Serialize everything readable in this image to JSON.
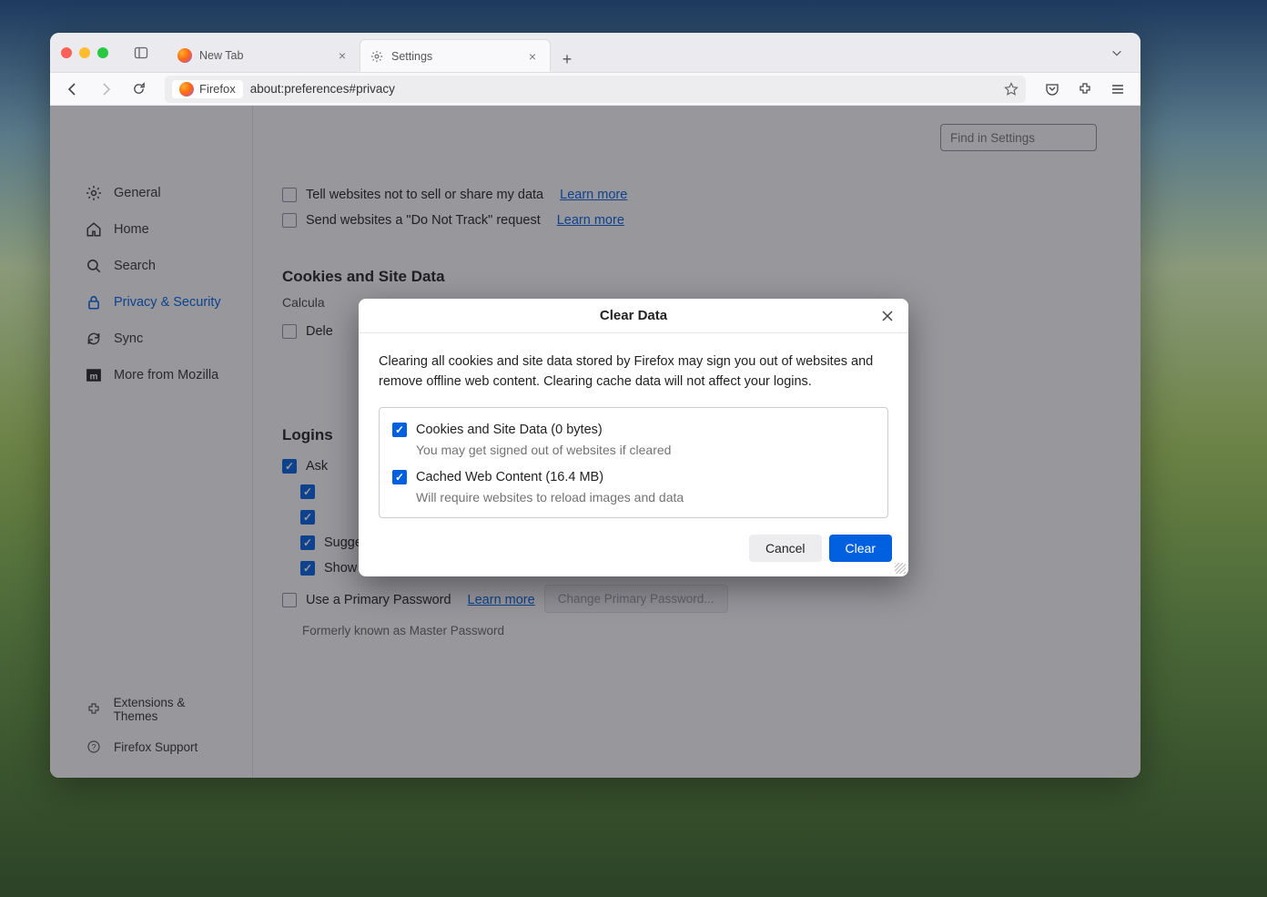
{
  "tabs": [
    {
      "label": "New Tab",
      "active": false
    },
    {
      "label": "Settings",
      "active": true
    }
  ],
  "urlbar": {
    "identity": "Firefox",
    "url": "about:preferences#privacy"
  },
  "search": {
    "placeholder": "Find in Settings"
  },
  "sidebar": {
    "items": [
      {
        "label": "General"
      },
      {
        "label": "Home"
      },
      {
        "label": "Search"
      },
      {
        "label": "Privacy & Security"
      },
      {
        "label": "Sync"
      },
      {
        "label": "More from Mozilla"
      }
    ],
    "footer": [
      {
        "label": "Extensions & Themes"
      },
      {
        "label": "Firefox Support"
      }
    ]
  },
  "privacy": {
    "dnt_sell": "Tell websites not to sell or share my data",
    "dnt_track": "Send websites a \"Do Not Track\" request",
    "learn": "Learn more",
    "cookies_title": "Cookies and Site Data",
    "cookies_calc": "Calcula",
    "cookies_delete": "Dele",
    "logins_title": "Logins",
    "ask": "Ask",
    "relay": "Suggest Firefox Relay email masks to protect your email address",
    "breach": "Show alerts about passwords for breached websites",
    "primary": "Use a Primary Password",
    "primary_note": "Formerly known as Master Password",
    "change_btn": "Change Primary Password..."
  },
  "dialog": {
    "title": "Clear Data",
    "desc": "Clearing all cookies and site data stored by Firefox may sign you out of websites and remove offline web content. Clearing cache data will not affect your logins.",
    "opt1": "Cookies and Site Data (0 bytes)",
    "opt1_sub": "You may get signed out of websites if cleared",
    "opt2": "Cached Web Content (16.4 MB)",
    "opt2_sub": "Will require websites to reload images and data",
    "cancel": "Cancel",
    "clear": "Clear"
  }
}
